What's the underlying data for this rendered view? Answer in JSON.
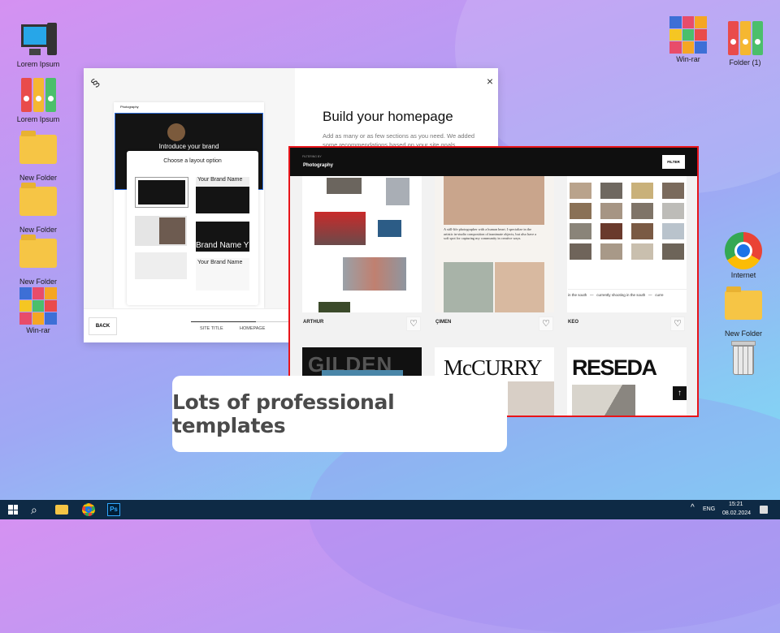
{
  "desktop": {
    "left_icons": [
      {
        "label": "Lorem Ipsum",
        "icon": "computer-icon"
      },
      {
        "label": "Lorem Ipsum",
        "icon": "binders-icon"
      },
      {
        "label": "New Folder",
        "icon": "folder-icon"
      },
      {
        "label": "New Folder",
        "icon": "folder-icon"
      },
      {
        "label": "New Folder",
        "icon": "folder-icon"
      },
      {
        "label": "Win-rar",
        "icon": "winrar-icon"
      }
    ],
    "right_icons": [
      {
        "label": "Win-rar",
        "icon": "winrar-icon"
      },
      {
        "label": "Folder (1)",
        "icon": "binders-icon"
      },
      {
        "label": "Internet",
        "icon": "chrome-icon"
      },
      {
        "label": "New Folder",
        "icon": "folder-icon"
      },
      {
        "label": "",
        "icon": "recycle-bin-icon"
      }
    ]
  },
  "builder": {
    "preview_site": "Photography",
    "hero_text": "Introduce your brand",
    "layout_title": "Choose a layout option",
    "layouts": [
      "Your Brand Name",
      "Brand Name Y",
      "Your Brand Name"
    ],
    "title": "Build your homepage",
    "description": "Add as many or as few sections as you need. We added some recommendations based on your site goals.",
    "back": "BACK",
    "steps": [
      "SITE TITLE",
      "HOMEPAGE"
    ]
  },
  "templates": {
    "filter_label": "FILTERING BY",
    "filter_value": "Photography",
    "filter_button": "FILTER",
    "cards": [
      {
        "name": "ARTHUR"
      },
      {
        "name": "ÇIMEN",
        "text": "A still-life photographer with a human heart. I specialize in the artistic in-studio composition of inanimate objects, but also have a soft spot for capturing my community in creative ways."
      },
      {
        "name": "KEO",
        "ticker": "in the south   —   currently shooting in the south   —   curre"
      }
    ],
    "more": [
      "GILDEN",
      "McCURRY",
      "RESEDA"
    ]
  },
  "caption": "Lots of professional templates",
  "taskbar": {
    "lang": "ENG",
    "time": "15:21",
    "date": "08.02.2024"
  },
  "colors": {
    "accent_red": "#e8141a",
    "taskbar": "#0e2a45"
  }
}
